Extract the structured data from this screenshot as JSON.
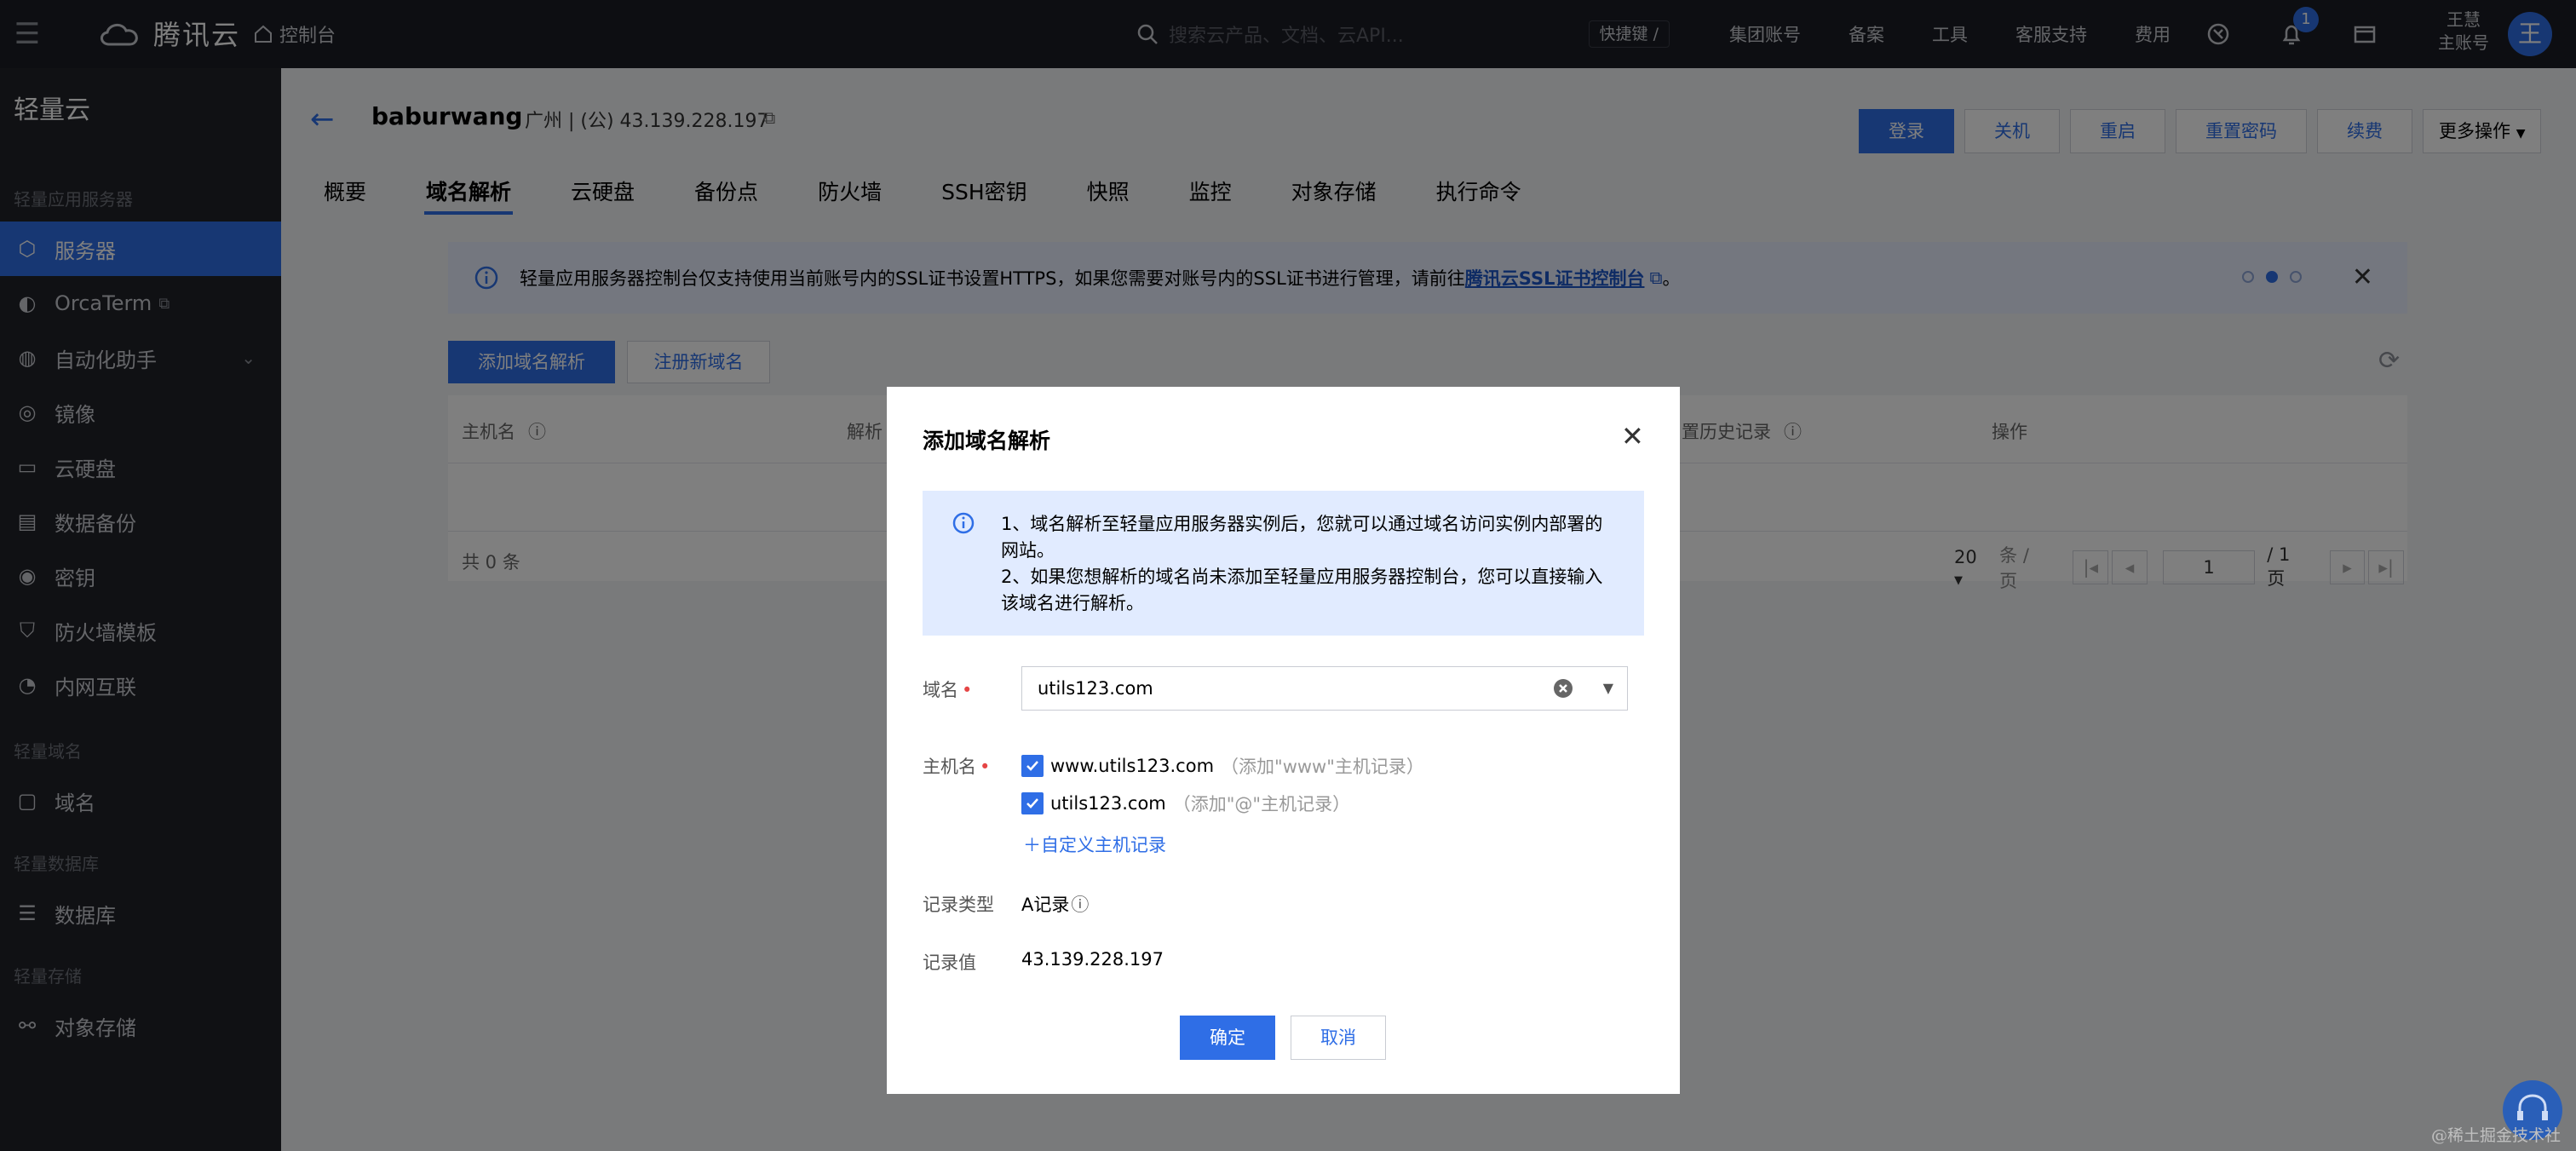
{
  "topbar": {
    "brand": "腾讯云",
    "console": "控制台",
    "search_placeholder": "搜索云产品、文档、云API...",
    "shortcut": "快捷键 /",
    "nav": [
      "集团账号",
      "备案",
      "工具",
      "客服支持",
      "费用"
    ],
    "notification_count": "1",
    "account_line1": "王慧",
    "account_line2": "主账号",
    "avatar_text": "王"
  },
  "sidebar": {
    "title": "轻量云",
    "groups": [
      "轻量应用服务器",
      "轻量域名",
      "轻量数据库",
      "轻量存储"
    ],
    "items": [
      {
        "label": "服务器",
        "icon": "cube-icon"
      },
      {
        "label": "OrcaTerm",
        "icon": "terminal-icon"
      },
      {
        "label": "自动化助手",
        "icon": "robot-icon"
      },
      {
        "label": "镜像",
        "icon": "image-icon"
      },
      {
        "label": "云硬盘",
        "icon": "disk-icon"
      },
      {
        "label": "数据备份",
        "icon": "backup-icon"
      },
      {
        "label": "密钥",
        "icon": "key-icon"
      },
      {
        "label": "防火墙模板",
        "icon": "shield-icon"
      },
      {
        "label": "内网互联",
        "icon": "network-icon"
      },
      {
        "label": "域名",
        "icon": "domain-icon"
      },
      {
        "label": "数据库",
        "icon": "database-icon"
      },
      {
        "label": "对象存储",
        "icon": "storage-icon"
      }
    ]
  },
  "instance": {
    "name": "baburwang",
    "meta": "广州  |  (公) 43.139.228.197"
  },
  "actions": [
    "登录",
    "关机",
    "重启",
    "重置密码",
    "续费",
    "更多操作"
  ],
  "tabs": [
    "概要",
    "域名解析",
    "云硬盘",
    "备份点",
    "防火墙",
    "SSH密钥",
    "快照",
    "监控",
    "对象存储",
    "执行命令"
  ],
  "notice": {
    "text": "轻量应用服务器控制台仅支持使用当前账号内的SSL证书设置HTTPS，如果您需要对账号内的SSL证书进行管理，请前往",
    "link": "腾讯云SSL证书控制台",
    "tail": "。"
  },
  "toolbar": {
    "add": "添加域名解析",
    "register": "注册新域名"
  },
  "table": {
    "headers": [
      "主机名",
      "解析",
      "置历史记录",
      "操作"
    ],
    "total": "共 0 条",
    "page_size": "20",
    "per_page": "条 / 页",
    "page": "1",
    "pages": "/ 1 页"
  },
  "modal": {
    "title": "添加域名解析",
    "info_line1": "1、域名解析至轻量应用服务器实例后，您就可以通过域名访问实例内部署的网站。",
    "info_line2": "2、如果您想解析的域名尚未添加至轻量应用服务器控制台，您可以直接输入该域名进行解析。",
    "domain_label": "域名",
    "domain_value": "utils123.com",
    "host_label": "主机名",
    "hosts": [
      {
        "name": "www.utils123.com",
        "hint": "（添加\"www\"主机记录）",
        "checked": true
      },
      {
        "name": "utils123.com",
        "hint": "（添加\"@\"主机记录）",
        "checked": true
      }
    ],
    "custom_host": "自定义主机记录",
    "record_type_label": "记录类型",
    "record_type": "A记录",
    "record_value_label": "记录值",
    "record_value": "43.139.228.197",
    "ok": "确定",
    "cancel": "取消"
  },
  "watermark": "@稀土掘金技术社区"
}
